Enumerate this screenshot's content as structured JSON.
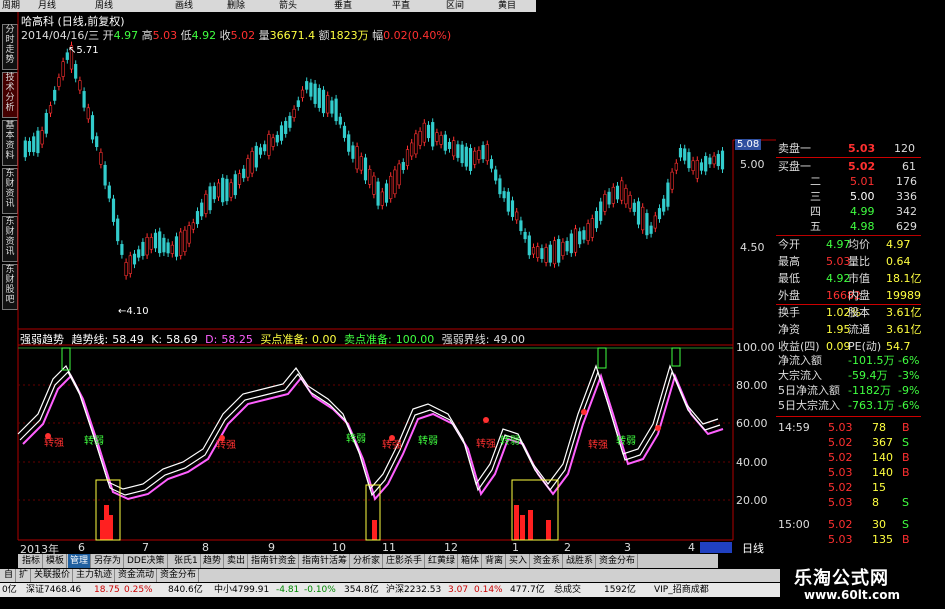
{
  "toolbar": {
    "items": [
      "周期",
      "月线",
      "周线",
      "画线",
      "删除",
      "箭头",
      "垂直",
      "平直",
      "区间",
      "黄目"
    ]
  },
  "side_tabs": [
    "分时走势",
    "技术分析",
    "基本资料",
    "东财资讯",
    "东财资讯",
    "东财股吧"
  ],
  "header": {
    "name": "哈高科",
    "period": "(日线,前复权)",
    "date": "2014/04/16/三",
    "open_label": "开",
    "open": "4.97",
    "high_label": "高",
    "high": "5.03",
    "low_label": "低",
    "low": "4.92",
    "close_label": "收",
    "close": "5.02",
    "vol_label": "量",
    "vol": "36671.4",
    "amt_label": "额",
    "amt": "1823万",
    "chg_label": "幅",
    "chg": "0.02",
    "chg_pct": "(0.40%)"
  },
  "price_chart": {
    "high_marker": "5.71",
    "low_marker": "4.10",
    "axis_labels": [
      "5.08",
      "5.00",
      "4.50"
    ]
  },
  "indicator": {
    "name": "强弱趋势",
    "trend_label": "趋势线:",
    "trend_val": "58.49",
    "k_label": "K:",
    "k_val": "58.69",
    "d_label": "D:",
    "d_val": "58.25",
    "buy_label": "买点准备:",
    "buy_val": "0.00",
    "sell_label": "卖点准备:",
    "sell_val": "100.00",
    "bound_label": "强弱界线:",
    "bound_val": "49.00",
    "axis_labels": [
      "100.00",
      "80.00",
      "60.00",
      "40.00",
      "20.00"
    ],
    "tags_strong": [
      "转强",
      "转强",
      "转强",
      "转强",
      "转强"
    ],
    "tags_weak": [
      "转弱",
      "转弱",
      "转弱",
      "转弱",
      "转弱"
    ]
  },
  "time_axis": {
    "labels": [
      "2013年",
      "6",
      "7",
      "8",
      "9",
      "10",
      "11",
      "12",
      "1",
      "2",
      "3",
      "4"
    ],
    "end_label": "日线"
  },
  "order_book": {
    "sell": [
      {
        "label": "卖盘一",
        "price": "5.03",
        "vol": "120"
      }
    ],
    "buy": [
      {
        "label": "买盘一",
        "price": "5.02",
        "vol": "61"
      },
      {
        "label": "二",
        "price": "5.01",
        "vol": "176"
      },
      {
        "label": "三",
        "price": "5.00",
        "vol": "336"
      },
      {
        "label": "四",
        "price": "4.99",
        "vol": "342"
      },
      {
        "label": "五",
        "price": "4.98",
        "vol": "629"
      }
    ]
  },
  "stats": [
    {
      "l1": "今开",
      "v1": "4.97",
      "l2": "均价",
      "v2": "4.97"
    },
    {
      "l1": "最高",
      "v1": "5.03",
      "l2": "量比",
      "v2": "0.64"
    },
    {
      "l1": "最低",
      "v1": "4.92",
      "l2": "市值",
      "v2": "18.1亿"
    },
    {
      "l1": "外盘",
      "v1": "16682",
      "l2": "内盘",
      "v2": "19989"
    },
    {
      "l1": "换手",
      "v1": "1.02%",
      "l2": "股本",
      "v2": "3.61亿"
    },
    {
      "l1": "净资",
      "v1": "1.95",
      "l2": "流通",
      "v2": "3.61亿"
    },
    {
      "l1": "收益(四)",
      "v1": "0.09",
      "l2": "PE(动)",
      "v2": "54.7"
    }
  ],
  "flows": [
    {
      "label": "净流入额",
      "val": "-101.5万",
      "pct": "-6%"
    },
    {
      "label": "大宗流入",
      "val": "-59.4万",
      "pct": "-3%"
    },
    {
      "label": "5日净流入额",
      "val": "-1182万",
      "pct": "-9%"
    },
    {
      "label": "5日大宗流入",
      "val": "-763.1万",
      "pct": "-6%"
    }
  ],
  "ticks": [
    {
      "time": "14:59",
      "price": "5.03",
      "vol": "78",
      "side": "B"
    },
    {
      "time": "",
      "price": "5.02",
      "vol": "367",
      "side": "S"
    },
    {
      "time": "",
      "price": "5.02",
      "vol": "140",
      "side": "B"
    },
    {
      "time": "",
      "price": "5.03",
      "vol": "140",
      "side": "B"
    },
    {
      "time": "",
      "price": "5.02",
      "vol": "15",
      "side": ""
    },
    {
      "time": "",
      "price": "5.03",
      "vol": "8",
      "side": "S"
    },
    {
      "time": "15:00",
      "price": "5.02",
      "vol": "30",
      "side": "S"
    },
    {
      "time": "",
      "price": "5.03",
      "vol": "135",
      "side": "B"
    }
  ],
  "bottom_tabs": [
    "指标",
    "模板",
    "管理",
    "另存为",
    "DDE决策",
    "张氏1",
    "趋势",
    "卖出",
    "指南针资金",
    "指南针活筹",
    "分析家",
    "庄影杀手",
    "红黄绿",
    "箱体",
    "背离",
    "买入",
    "资金系",
    "战胜系",
    "资金分布"
  ],
  "bottom_tabs2": [
    "自",
    "扩",
    "关联报价",
    "主力轨迹",
    "资金流动",
    "资金分布"
  ],
  "status": {
    "a": "0亿",
    "b": "深证7468.46",
    "c": "18.75",
    "d": "0.25%",
    "e": "840.6亿",
    "f": "中小4799.91",
    "g": "-4.81",
    "h": "-0.10%",
    "i": "354.8亿",
    "j": "沪深2232.53",
    "k": "3.07",
    "l": "0.14%",
    "m": "477.7亿",
    "n": "总成交",
    "o": "1592亿",
    "p": "VIP_招商成都"
  },
  "watermark": {
    "line1": "乐淘公式网",
    "line2": "www.60lt.com"
  },
  "colors": {
    "up": "#ff3030",
    "down": "#33cccc",
    "frame": "#b00000",
    "yellow": "#ffff40",
    "green": "#40ff40",
    "magenta": "#ff60ff"
  }
}
